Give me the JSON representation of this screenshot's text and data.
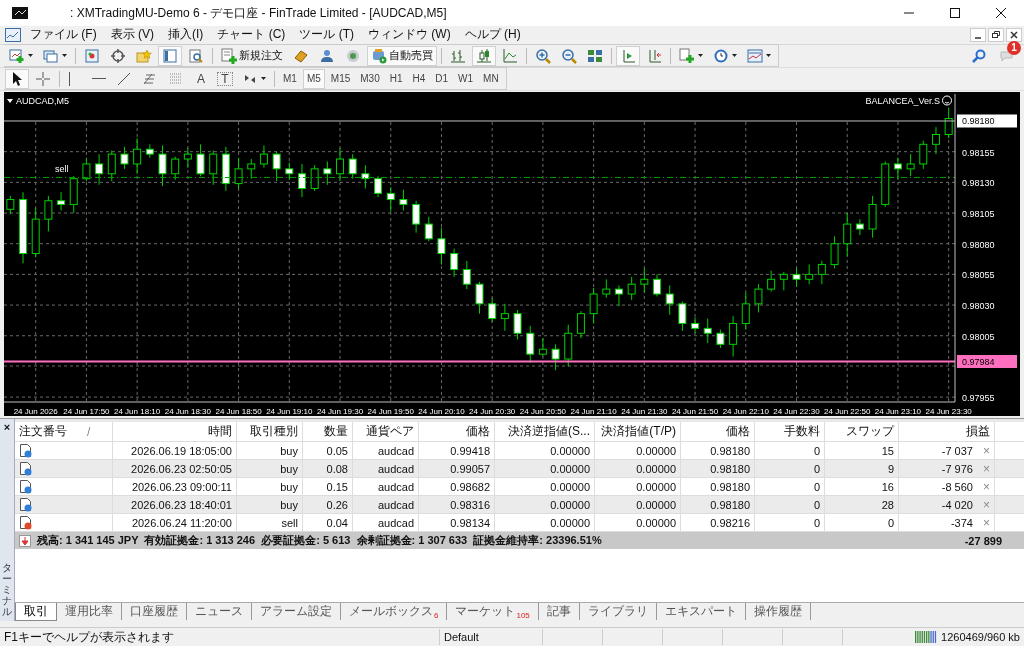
{
  "window": {
    "title": ": XMTradingMU-Demo 6 - デモ口座 - FinTrade Limited - [AUDCAD,M5]"
  },
  "menu": [
    {
      "label": "ファイル (F)"
    },
    {
      "label": "表示 (V)"
    },
    {
      "label": "挿入(I)"
    },
    {
      "label": "チャート (C)"
    },
    {
      "label": "ツール (T)"
    },
    {
      "label": "ウィンドウ (W)"
    },
    {
      "label": "ヘルプ (H)"
    }
  ],
  "toolbar": [
    {
      "kind": "new-chart",
      "selected": false
    },
    {
      "kind": "profiles",
      "selected": false
    },
    {
      "kind": "sep"
    },
    {
      "kind": "market-watch",
      "selected": false
    },
    {
      "kind": "navigator",
      "selected": false
    },
    {
      "kind": "favorites",
      "selected": false
    },
    {
      "kind": "data-window",
      "selected": true
    },
    {
      "kind": "tester",
      "selected": false
    },
    {
      "kind": "sep"
    },
    {
      "kind": "new-order",
      "label": "新規注文",
      "selected": false
    },
    {
      "kind": "gold",
      "selected": false
    },
    {
      "kind": "people",
      "selected": false
    },
    {
      "kind": "signal",
      "selected": false
    },
    {
      "kind": "auto-trade",
      "label": "自動売買",
      "selected": true
    },
    {
      "kind": "sep"
    },
    {
      "kind": "bar-chart",
      "selected": false
    },
    {
      "kind": "candles",
      "selected": true
    },
    {
      "kind": "line-chart",
      "selected": false
    },
    {
      "kind": "sep"
    },
    {
      "kind": "zoom-in",
      "selected": false
    },
    {
      "kind": "zoom-out",
      "selected": false
    },
    {
      "kind": "tile",
      "selected": false
    },
    {
      "kind": "sep"
    },
    {
      "kind": "auto-scroll",
      "selected": true
    },
    {
      "kind": "chart-shift",
      "selected": false
    },
    {
      "kind": "sep"
    },
    {
      "kind": "indicators",
      "selected": false
    },
    {
      "kind": "periods",
      "selected": false
    },
    {
      "kind": "templates",
      "selected": false
    }
  ],
  "draw_tools": [
    {
      "kind": "cursor",
      "selected": true
    },
    {
      "kind": "crosshair",
      "selected": false
    },
    {
      "kind": "sep"
    },
    {
      "kind": "vline",
      "selected": false
    },
    {
      "kind": "hline",
      "selected": false
    },
    {
      "kind": "trend",
      "selected": false
    },
    {
      "kind": "fibo",
      "selected": false
    },
    {
      "kind": "channel",
      "selected": false
    },
    {
      "kind": "text",
      "label": "A",
      "selected": false
    },
    {
      "kind": "label",
      "label": "T",
      "selected": false
    },
    {
      "kind": "arrows",
      "selected": false
    }
  ],
  "timeframes": [
    {
      "label": "M1",
      "selected": false
    },
    {
      "label": "M5",
      "selected": true
    },
    {
      "label": "M15",
      "selected": false
    },
    {
      "label": "M30",
      "selected": false
    },
    {
      "label": "H1",
      "selected": false
    },
    {
      "label": "H4",
      "selected": false
    },
    {
      "label": "D1",
      "selected": false
    },
    {
      "label": "W1",
      "selected": false
    },
    {
      "label": "MN",
      "selected": false
    }
  ],
  "notifications": {
    "count": "1"
  },
  "chart": {
    "symbol": "AUDCAD,M5",
    "expert": "BALANCEA_Ver.S",
    "order_label": "sell",
    "ask_label": "0.98180",
    "bid_label": "0.97984",
    "chart_data": {
      "type": "candlestick",
      "grid": true,
      "ylim": [
        0.97951,
        0.98202
      ],
      "categories": [
        null,
        null,
        "24 Jun 2026",
        null,
        null,
        null,
        "24 Jun 17:50",
        null,
        null,
        null,
        "24 Jun 18:10",
        null,
        null,
        null,
        "24 Jun 18:30",
        null,
        null,
        null,
        "24 Jun 18:50",
        null,
        null,
        null,
        "24 Jun 19:10",
        null,
        null,
        null,
        "24 Jun 19:30",
        null,
        null,
        null,
        "24 Jun 19:50",
        null,
        null,
        null,
        "24 Jun 20:10",
        null,
        null,
        null,
        "24 Jun 20:30",
        null,
        null,
        null,
        "24 Jun 20:50",
        null,
        null,
        null,
        "24 Jun 21:10",
        null,
        null,
        null,
        "24 Jun 21:30",
        null,
        null,
        null,
        "24 Jun 21:50",
        null,
        null,
        null,
        "24 Jun 22:10",
        null,
        null,
        null,
        "24 Jun 22:30",
        null,
        null,
        null,
        "24 Jun 22:50",
        null,
        null,
        null,
        "24 Jun 23:10",
        null,
        null,
        null,
        "24 Jun 23:30"
      ],
      "ref_lines": [
        {
          "axis": "y",
          "value": 0.9818,
          "color": "#c0c0c0"
        },
        {
          "axis": "y",
          "value": 0.98134,
          "color": "#00a000"
        },
        {
          "axis": "y",
          "value": 0.97984,
          "color": "#ff6fc0"
        }
      ],
      "ohlc": [
        [
          0.98108,
          0.98119,
          0.98104,
          0.98116
        ],
        [
          0.98116,
          0.98122,
          0.98064,
          0.98072
        ],
        [
          0.98072,
          0.98109,
          0.98069,
          0.981
        ],
        [
          0.981,
          0.98119,
          0.9809,
          0.98115
        ],
        [
          0.98115,
          0.98122,
          0.98107,
          0.98112
        ],
        [
          0.98112,
          0.98135,
          0.98105,
          0.98133
        ],
        [
          0.98133,
          0.9815,
          0.98131,
          0.98145
        ],
        [
          0.98145,
          0.98153,
          0.98128,
          0.98137
        ],
        [
          0.98137,
          0.98156,
          0.98131,
          0.98153
        ],
        [
          0.98153,
          0.98159,
          0.98141,
          0.98145
        ],
        [
          0.98145,
          0.98166,
          0.98137,
          0.98157
        ],
        [
          0.98157,
          0.98161,
          0.9815,
          0.98153
        ],
        [
          0.98153,
          0.9816,
          0.98127,
          0.98137
        ],
        [
          0.98137,
          0.98151,
          0.98132,
          0.98149
        ],
        [
          0.98149,
          0.98158,
          0.98142,
          0.98153
        ],
        [
          0.98153,
          0.98161,
          0.98135,
          0.98137
        ],
        [
          0.98137,
          0.98156,
          0.98128,
          0.98153
        ],
        [
          0.98153,
          0.98159,
          0.98123,
          0.98129
        ],
        [
          0.98129,
          0.9815,
          0.98125,
          0.98141
        ],
        [
          0.98141,
          0.98149,
          0.98133,
          0.98145
        ],
        [
          0.98145,
          0.9816,
          0.98142,
          0.98153
        ],
        [
          0.98153,
          0.98155,
          0.98131,
          0.98141
        ],
        [
          0.98141,
          0.98146,
          0.98132,
          0.98137
        ],
        [
          0.98137,
          0.98145,
          0.98118,
          0.98125
        ],
        [
          0.98125,
          0.98144,
          0.98123,
          0.98141
        ],
        [
          0.98141,
          0.98147,
          0.98128,
          0.98137
        ],
        [
          0.98137,
          0.98158,
          0.98131,
          0.98149
        ],
        [
          0.98149,
          0.98153,
          0.98133,
          0.98137
        ],
        [
          0.98137,
          0.98144,
          0.98125,
          0.98133
        ],
        [
          0.98133,
          0.98135,
          0.98118,
          0.98121
        ],
        [
          0.98121,
          0.98126,
          0.98106,
          0.98116
        ],
        [
          0.98116,
          0.98124,
          0.98107,
          0.98112
        ],
        [
          0.98112,
          0.98115,
          0.98089,
          0.98096
        ],
        [
          0.98096,
          0.98102,
          0.98082,
          0.98084
        ],
        [
          0.98084,
          0.98093,
          0.98063,
          0.98072
        ],
        [
          0.98072,
          0.98076,
          0.98053,
          0.98059
        ],
        [
          0.98059,
          0.98066,
          0.98043,
          0.98047
        ],
        [
          0.98047,
          0.98049,
          0.98023,
          0.98031
        ],
        [
          0.98031,
          0.98036,
          0.98016,
          0.98019
        ],
        [
          0.98019,
          0.98031,
          0.98009,
          0.98023
        ],
        [
          0.98023,
          0.98026,
          0.98002,
          0.98007
        ],
        [
          0.98007,
          0.98013,
          0.97983,
          0.9799
        ],
        [
          0.9799,
          0.98003,
          0.97988,
          0.97994
        ],
        [
          0.97994,
          0.97998,
          0.97977,
          0.97986
        ],
        [
          0.97986,
          0.98014,
          0.9798,
          0.98007
        ],
        [
          0.98007,
          0.98025,
          0.98003,
          0.98023
        ],
        [
          0.98023,
          0.98044,
          0.98015,
          0.98039
        ],
        [
          0.98039,
          0.98051,
          0.98036,
          0.98043
        ],
        [
          0.98043,
          0.98046,
          0.98029,
          0.98039
        ],
        [
          0.98039,
          0.98053,
          0.98034,
          0.98047
        ],
        [
          0.98047,
          0.9806,
          0.9804,
          0.98051
        ],
        [
          0.98051,
          0.98055,
          0.98037,
          0.98039
        ],
        [
          0.98039,
          0.98046,
          0.98022,
          0.98031
        ],
        [
          0.98031,
          0.98033,
          0.98009,
          0.98015
        ],
        [
          0.98015,
          0.9802,
          0.98007,
          0.98011
        ],
        [
          0.98011,
          0.98019,
          0.97999,
          0.98007
        ],
        [
          0.98007,
          0.9801,
          0.97995,
          0.97998
        ],
        [
          0.97998,
          0.98021,
          0.97988,
          0.98015
        ],
        [
          0.98015,
          0.9804,
          0.9801,
          0.98031
        ],
        [
          0.98031,
          0.98047,
          0.98024,
          0.98043
        ],
        [
          0.98043,
          0.98058,
          0.98041,
          0.98051
        ],
        [
          0.98051,
          0.98057,
          0.98042,
          0.98055
        ],
        [
          0.98055,
          0.9806,
          0.98045,
          0.98051
        ],
        [
          0.98051,
          0.98063,
          0.98047,
          0.98055
        ],
        [
          0.98055,
          0.98066,
          0.98047,
          0.98063
        ],
        [
          0.98063,
          0.98086,
          0.9806,
          0.9808
        ],
        [
          0.9808,
          0.98105,
          0.9807,
          0.98096
        ],
        [
          0.98096,
          0.981,
          0.98087,
          0.98092
        ],
        [
          0.98092,
          0.98119,
          0.98085,
          0.98112
        ],
        [
          0.98112,
          0.98147,
          0.9811,
          0.98145
        ],
        [
          0.98145,
          0.9815,
          0.98132,
          0.98141
        ],
        [
          0.98141,
          0.98153,
          0.98135,
          0.98145
        ],
        [
          0.98145,
          0.98164,
          0.98141,
          0.98161
        ],
        [
          0.98161,
          0.98175,
          0.98153,
          0.98169
        ],
        [
          0.98169,
          0.98191,
          0.98166,
          0.98182
        ]
      ],
      "yticks": [
        {
          "value": 0.98155,
          "label": "0.98155"
        },
        {
          "value": 0.9813,
          "label": "0.98130"
        },
        {
          "value": 0.98105,
          "label": "0.98105"
        },
        {
          "value": 0.9808,
          "label": "0.98080"
        },
        {
          "value": 0.98055,
          "label": "0.98055"
        },
        {
          "value": 0.9803,
          "label": "0.98030"
        },
        {
          "value": 0.98005,
          "label": "0.98005"
        },
        {
          "value": 0.97955,
          "label": "0.97955"
        }
      ]
    }
  },
  "terminal": {
    "title": "ターミナル",
    "close": "×",
    "sort_mark": "/",
    "columns": [
      "注文番号",
      "時間",
      "取引種別",
      "数量",
      "通貨ペア",
      "価格",
      "決済逆指値(S...",
      "決済指値(T/P)",
      "価格",
      "手数料",
      "スワップ",
      "損益"
    ],
    "rows": [
      {
        "color": "#2f7fd8",
        "time": "2026.06.19 18:05:00",
        "type": "buy",
        "volume": "0.05",
        "symbol": "audcad",
        "open_price": "0.99418",
        "sl": "0.00000",
        "tp": "0.00000",
        "price": "0.98180",
        "commission": "0",
        "swap": "15",
        "profit": "-7 037",
        "close": "×"
      },
      {
        "color": "#2f7fd8",
        "time": "2026.06.23 02:50:05",
        "type": "buy",
        "volume": "0.08",
        "symbol": "audcad",
        "open_price": "0.99057",
        "sl": "0.00000",
        "tp": "0.00000",
        "price": "0.98180",
        "commission": "0",
        "swap": "9",
        "profit": "-7 976",
        "close": "×"
      },
      {
        "color": "#2f7fd8",
        "time": "2026.06.23 09:00:11",
        "type": "buy",
        "volume": "0.15",
        "symbol": "audcad",
        "open_price": "0.98682",
        "sl": "0.00000",
        "tp": "0.00000",
        "price": "0.98180",
        "commission": "0",
        "swap": "16",
        "profit": "-8 560",
        "close": "×"
      },
      {
        "color": "#2f7fd8",
        "time": "2026.06.23 18:40:01",
        "type": "buy",
        "volume": "0.26",
        "symbol": "audcad",
        "open_price": "0.98316",
        "sl": "0.00000",
        "tp": "0.00000",
        "price": "0.98180",
        "commission": "0",
        "swap": "28",
        "profit": "-4 020",
        "close": "×"
      },
      {
        "color": "#e0482a",
        "time": "2026.06.24 11:20:00",
        "type": "sell",
        "volume": "0.04",
        "symbol": "audcad",
        "open_price": "0.98134",
        "sl": "0.00000",
        "tp": "0.00000",
        "price": "0.98216",
        "commission": "0",
        "swap": "0",
        "profit": "-374",
        "close": "×"
      }
    ],
    "summary": {
      "text": "残高: 1 341 145 JPY  有効証拠金: 1 313 246  必要証拠金: 5 613  余剰証拠金: 1 307 633  証拠金維持率: 23396.51%",
      "profit": "-27 899"
    },
    "tabs": [
      {
        "label": "取引",
        "selected": true
      },
      {
        "label": "運用比率",
        "selected": false
      },
      {
        "label": "口座履歴",
        "selected": false
      },
      {
        "label": "ニュース",
        "selected": false
      },
      {
        "label": "アラーム設定",
        "selected": false
      },
      {
        "label": "メールボックス",
        "badge": "6",
        "selected": false
      },
      {
        "label": "マーケット",
        "badge": "105",
        "selected": false
      },
      {
        "label": "記事",
        "selected": false
      },
      {
        "label": "ライブラリ",
        "selected": false
      },
      {
        "label": "エキスパート",
        "selected": false
      },
      {
        "label": "操作履歴",
        "selected": false
      }
    ]
  },
  "status_bar": {
    "help": "F1キーでヘルプが表示されます",
    "profile": "Default",
    "traffic": "1260469/960 kb"
  }
}
